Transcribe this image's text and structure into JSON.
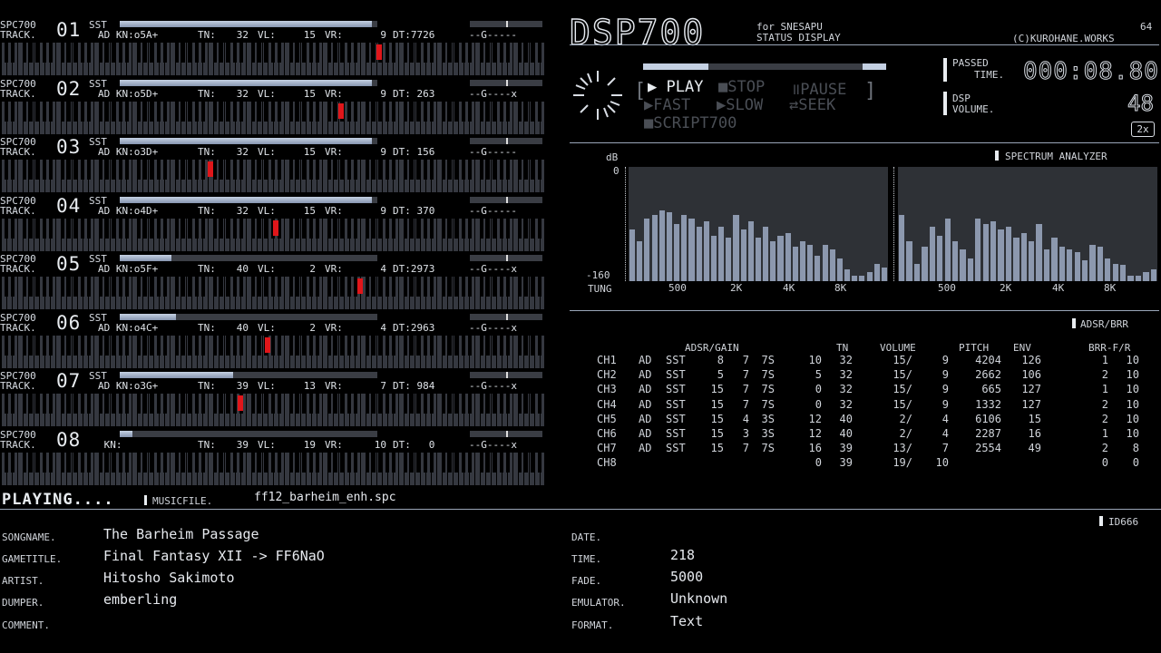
{
  "tracks": [
    {
      "label1": "SPC700",
      "label2": "TRACK.",
      "sst": "SST",
      "num": "01",
      "ad": "AD",
      "kn": "KN:o5A+",
      "tn": "TN:",
      "tnv": "32",
      "vl": "VL:",
      "vlv": "15",
      "vr": "VR:",
      "vrv": "9",
      "dt": "DT:7726",
      "mask": "--G-----",
      "level": 0.98,
      "key": 0.69
    },
    {
      "label1": "SPC700",
      "label2": "TRACK.",
      "sst": "SST",
      "num": "02",
      "ad": "AD",
      "kn": "KN:o5D+",
      "tn": "TN:",
      "tnv": "32",
      "vl": "VL:",
      "vlv": "15",
      "vr": "VR:",
      "vrv": "9",
      "dt": "DT: 263",
      "mask": "--G----x",
      "level": 0.98,
      "key": 0.62
    },
    {
      "label1": "SPC700",
      "label2": "TRACK.",
      "sst": "SST",
      "num": "03",
      "ad": "AD",
      "kn": "KN:o3D+",
      "tn": "TN:",
      "tnv": "32",
      "vl": "VL:",
      "vlv": "15",
      "vr": "VR:",
      "vrv": "9",
      "dt": "DT: 156",
      "mask": "--G-----",
      "level": 0.98,
      "key": 0.38
    },
    {
      "label1": "SPC700",
      "label2": "TRACK.",
      "sst": "SST",
      "num": "04",
      "ad": "AD",
      "kn": "KN:o4D+",
      "tn": "TN:",
      "tnv": "32",
      "vl": "VL:",
      "vlv": "15",
      "vr": "VR:",
      "vrv": "9",
      "dt": "DT: 370",
      "mask": "--G-----",
      "level": 0.98,
      "key": 0.5
    },
    {
      "label1": "SPC700",
      "label2": "TRACK.",
      "sst": "SST",
      "num": "05",
      "ad": "AD",
      "kn": "KN:o5F+",
      "tn": "TN:",
      "tnv": "40",
      "vl": "VL:",
      "vlv": "2",
      "vr": "VR:",
      "vrv": "4",
      "dt": "DT:2973",
      "mask": "--G----x",
      "level": 0.2,
      "key": 0.655
    },
    {
      "label1": "SPC700",
      "label2": "TRACK.",
      "sst": "SST",
      "num": "06",
      "ad": "AD",
      "kn": "KN:o4C+",
      "tn": "TN:",
      "tnv": "40",
      "vl": "VL:",
      "vlv": "2",
      "vr": "VR:",
      "vrv": "4",
      "dt": "DT:2963",
      "mask": "--G----x",
      "level": 0.22,
      "key": 0.485
    },
    {
      "label1": "SPC700",
      "label2": "TRACK.",
      "sst": "SST",
      "num": "07",
      "ad": "AD",
      "kn": "KN:o3G+",
      "tn": "TN:",
      "tnv": "39",
      "vl": "VL:",
      "vlv": "13",
      "vr": "VR:",
      "vrv": "7",
      "dt": "DT: 984",
      "mask": "--G----x",
      "level": 0.44,
      "key": 0.435
    },
    {
      "label1": "SPC700",
      "label2": "TRACK.",
      "sst": "",
      "num": "08",
      "ad": "",
      "kn": "KN:",
      "tn": "TN:",
      "tnv": "39",
      "vl": "VL:",
      "vlv": "19",
      "vr": "VR:",
      "vrv": "10",
      "dt": "DT:   0",
      "mask": "--G----x",
      "level": 0.05,
      "key": null
    }
  ],
  "status": {
    "playing": "PLAYING....",
    "musicfile_label": "MUSICFILE.",
    "musicfile": "ff12_barheim_enh.spc"
  },
  "header": {
    "logo": "DSP700",
    "for": "for SNESAPU",
    "status": "STATUS DISPLAY",
    "num": "64",
    "credit": "(C)KUROHANE.WORKS"
  },
  "controls": {
    "play": "PLAY",
    "stop": "STOP",
    "pause": "PAUSE",
    "fast": "FAST",
    "slow": "SLOW",
    "seek": "SEEK",
    "script": "SCRIPT700",
    "progress": 0.27
  },
  "passed": {
    "label1": "PASSED",
    "label2": "TIME.",
    "value": "000:08.80"
  },
  "dsp": {
    "label1": "DSP",
    "label2": "VOLUME.",
    "value": "48",
    "mult": "2x"
  },
  "spectrum": {
    "title": "SPECTRUM ANALYZER",
    "db": "dB",
    "top": "0",
    "bottom": "-160",
    "tune": "TUNG",
    "ticks": [
      "500",
      "2K",
      "4K",
      "8K"
    ],
    "left": [
      0.45,
      0.35,
      0.55,
      0.58,
      0.62,
      0.6,
      0.5,
      0.58,
      0.55,
      0.48,
      0.52,
      0.4,
      0.48,
      0.38,
      0.58,
      0.45,
      0.52,
      0.38,
      0.48,
      0.35,
      0.4,
      0.42,
      0.3,
      0.35,
      0.32,
      0.22,
      0.32,
      0.28,
      0.2,
      0.1,
      0.05,
      0.05,
      0.08,
      0.15,
      0.12
    ],
    "right": [
      0.58,
      0.35,
      0.15,
      0.3,
      0.48,
      0.4,
      0.55,
      0.35,
      0.28,
      0.2,
      0.55,
      0.5,
      0.52,
      0.45,
      0.48,
      0.38,
      0.42,
      0.35,
      0.5,
      0.28,
      0.38,
      0.3,
      0.28,
      0.25,
      0.18,
      0.32,
      0.3,
      0.2,
      0.15,
      0.14,
      0.05,
      0.05,
      0.08,
      0.1
    ]
  },
  "adsr": {
    "title": "ADSR/BRR",
    "headers": {
      "adsr": "ADSR/GAIN",
      "tn": "TN",
      "volume": "VOLUME",
      "pitch": "PITCH",
      "env": "ENV",
      "brr": "BRR-F/R"
    },
    "rows": [
      [
        "CH1",
        "AD",
        "SST",
        "8",
        "7",
        "7S",
        "10",
        "32",
        "15/",
        "9",
        "4204",
        "126",
        "1",
        "10"
      ],
      [
        "CH2",
        "AD",
        "SST",
        "5",
        "7",
        "7S",
        "5",
        "32",
        "15/",
        "9",
        "2662",
        "106",
        "2",
        "10"
      ],
      [
        "CH3",
        "AD",
        "SST",
        "15",
        "7",
        "7S",
        "0",
        "32",
        "15/",
        "9",
        "665",
        "127",
        "1",
        "10"
      ],
      [
        "CH4",
        "AD",
        "SST",
        "15",
        "7",
        "7S",
        "0",
        "32",
        "15/",
        "9",
        "1332",
        "127",
        "2",
        "10"
      ],
      [
        "CH5",
        "AD",
        "SST",
        "15",
        "4",
        "3S",
        "12",
        "40",
        "2/",
        "4",
        "6106",
        "15",
        "2",
        "10"
      ],
      [
        "CH6",
        "AD",
        "SST",
        "15",
        "3",
        "3S",
        "12",
        "40",
        "2/",
        "4",
        "2287",
        "16",
        "1",
        "10"
      ],
      [
        "CH7",
        "AD",
        "SST",
        "15",
        "7",
        "7S",
        "16",
        "39",
        "13/",
        "7",
        "2554",
        "49",
        "2",
        "8"
      ],
      [
        "CH8",
        "",
        "",
        "",
        "",
        "",
        "0",
        "39",
        "19/",
        "10",
        "",
        "",
        "0",
        "0"
      ]
    ]
  },
  "info": {
    "id": "ID666",
    "songname_label": "SONGNAME.",
    "songname": "The Barheim Passage",
    "gametitle_label": "GAMETITLE.",
    "gametitle": "Final Fantasy XII -> FF6NaO",
    "artist_label": "ARTIST.",
    "artist": "Hitosho Sakimoto",
    "dumper_label": "DUMPER.",
    "dumper": "emberling",
    "comment_label": "COMMENT.",
    "comment": "",
    "date_label": "DATE.",
    "date": "",
    "time_label": "TIME.",
    "time": "218",
    "fade_label": "FADE.",
    "fade": "5000",
    "emulator_label": "EMULATOR.",
    "emulator": "Unknown",
    "format_label": "FORMAT.",
    "format": "Text"
  },
  "colors": {
    "accent": "#e0161a",
    "bar": "#8c98ae",
    "line": "#9aa6b8"
  }
}
